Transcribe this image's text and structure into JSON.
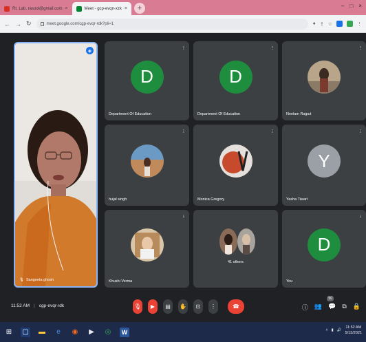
{
  "browser": {
    "tabs": [
      {
        "label": "Rt. Lab. rasool@gmail.com",
        "active": false,
        "fav_color": "#d93025"
      },
      {
        "label": "Meet - gcp-evqn-xzk",
        "active": true,
        "fav_color": "#00832d"
      }
    ],
    "url": "meet.google.com/cgp-evqr-rdk?pli=1"
  },
  "self": {
    "name": "Sangeeta ghosh"
  },
  "tiles": [
    {
      "name": "Department Of Education",
      "type": "letter",
      "letter": "D",
      "color": "#1e8e3e"
    },
    {
      "name": "Department Of Education",
      "type": "letter",
      "letter": "D",
      "color": "#1e8e3e"
    },
    {
      "name": "Neelam Rajput",
      "type": "photo"
    },
    {
      "name": "hujal singh",
      "type": "photo"
    },
    {
      "name": "Monica Gregory",
      "type": "photo"
    },
    {
      "name": "Yasha Tiwari",
      "type": "letter",
      "letter": "Y",
      "color": "#9aa0a6"
    },
    {
      "name": "Khushi Verma",
      "type": "photo"
    },
    {
      "name": "41 others",
      "type": "others"
    },
    {
      "name": "You",
      "type": "letter",
      "letter": "D",
      "color": "#1e8e3e"
    }
  ],
  "meeting": {
    "time": "11:52 AM",
    "code": "cgp-evqr-rdk",
    "participant_count": "50"
  },
  "taskbar": {
    "time": "11:52 AM",
    "date": "5/13/2021"
  }
}
